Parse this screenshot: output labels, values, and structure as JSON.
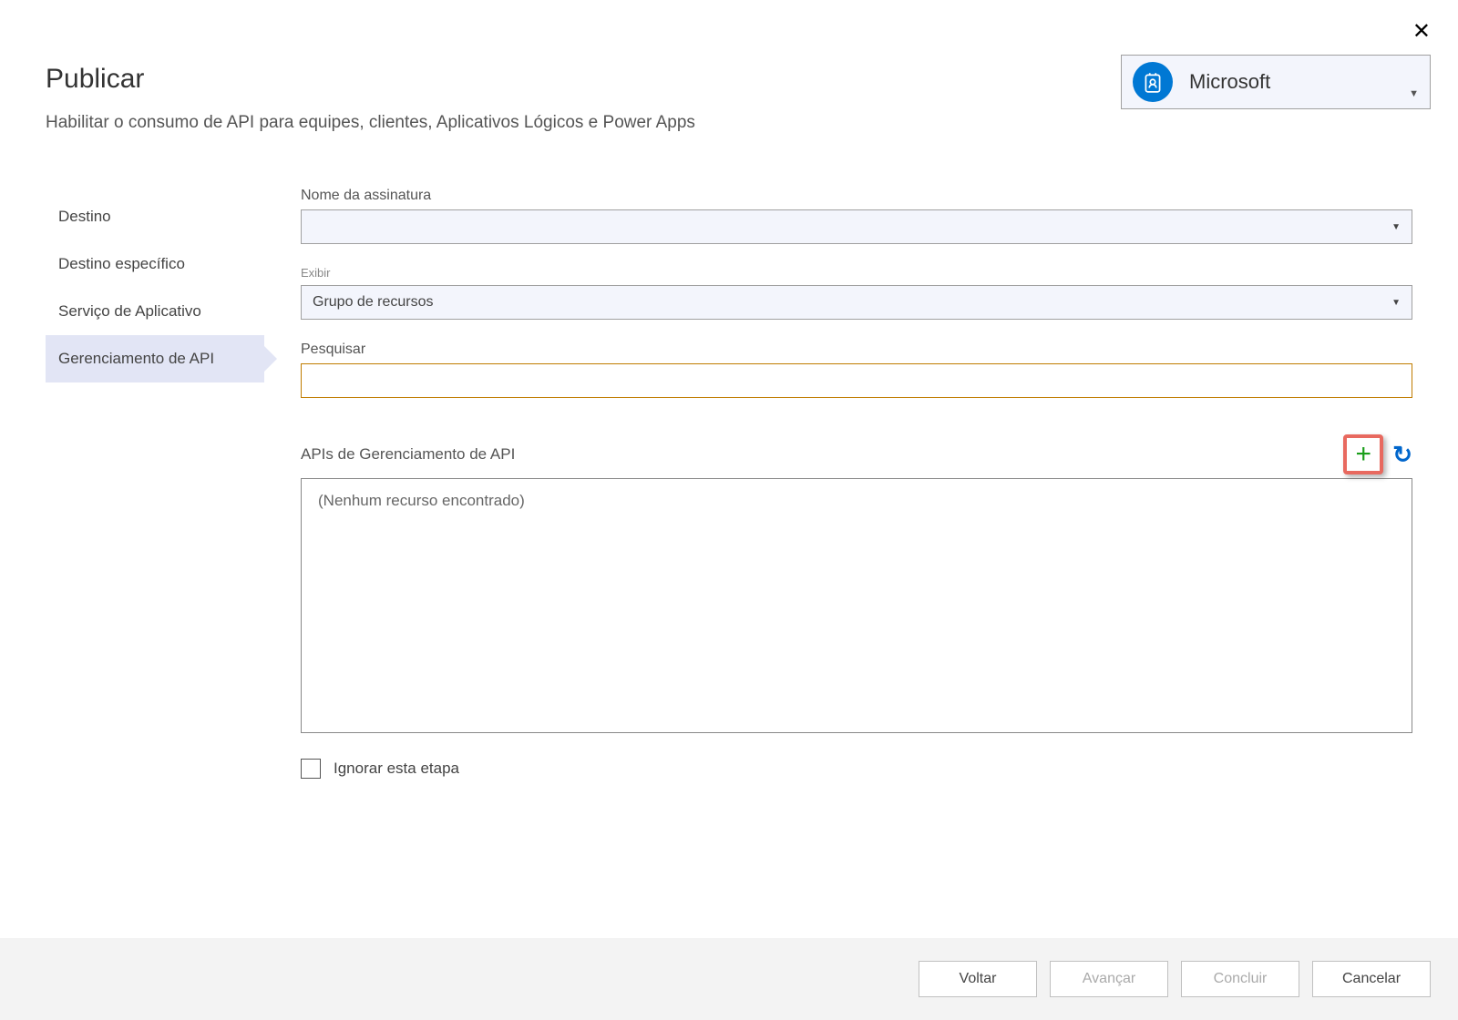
{
  "close_label": "✕",
  "header": {
    "title": "Publicar",
    "subtitle": "Habilitar o consumo de API para equipes, clientes, Aplicativos Lógicos e Power Apps"
  },
  "account": {
    "label": "Microsoft"
  },
  "sidebar": {
    "items": [
      {
        "label": "Destino"
      },
      {
        "label": "Destino específico"
      },
      {
        "label": "Serviço de Aplicativo"
      },
      {
        "label": "Gerenciamento de API"
      }
    ]
  },
  "form": {
    "subscription_label": "Nome da assinatura",
    "subscription_value": "",
    "view_label": "Exibir",
    "view_value": "Grupo de recursos",
    "search_label": "Pesquisar",
    "search_value": "",
    "api_section_label": "APIs de Gerenciamento de API",
    "api_empty_text": "(Nenhum recurso encontrado)",
    "skip_label": "Ignorar esta etapa"
  },
  "footer": {
    "back": "Voltar",
    "next": "Avançar",
    "finish": "Concluir",
    "cancel": "Cancelar"
  }
}
